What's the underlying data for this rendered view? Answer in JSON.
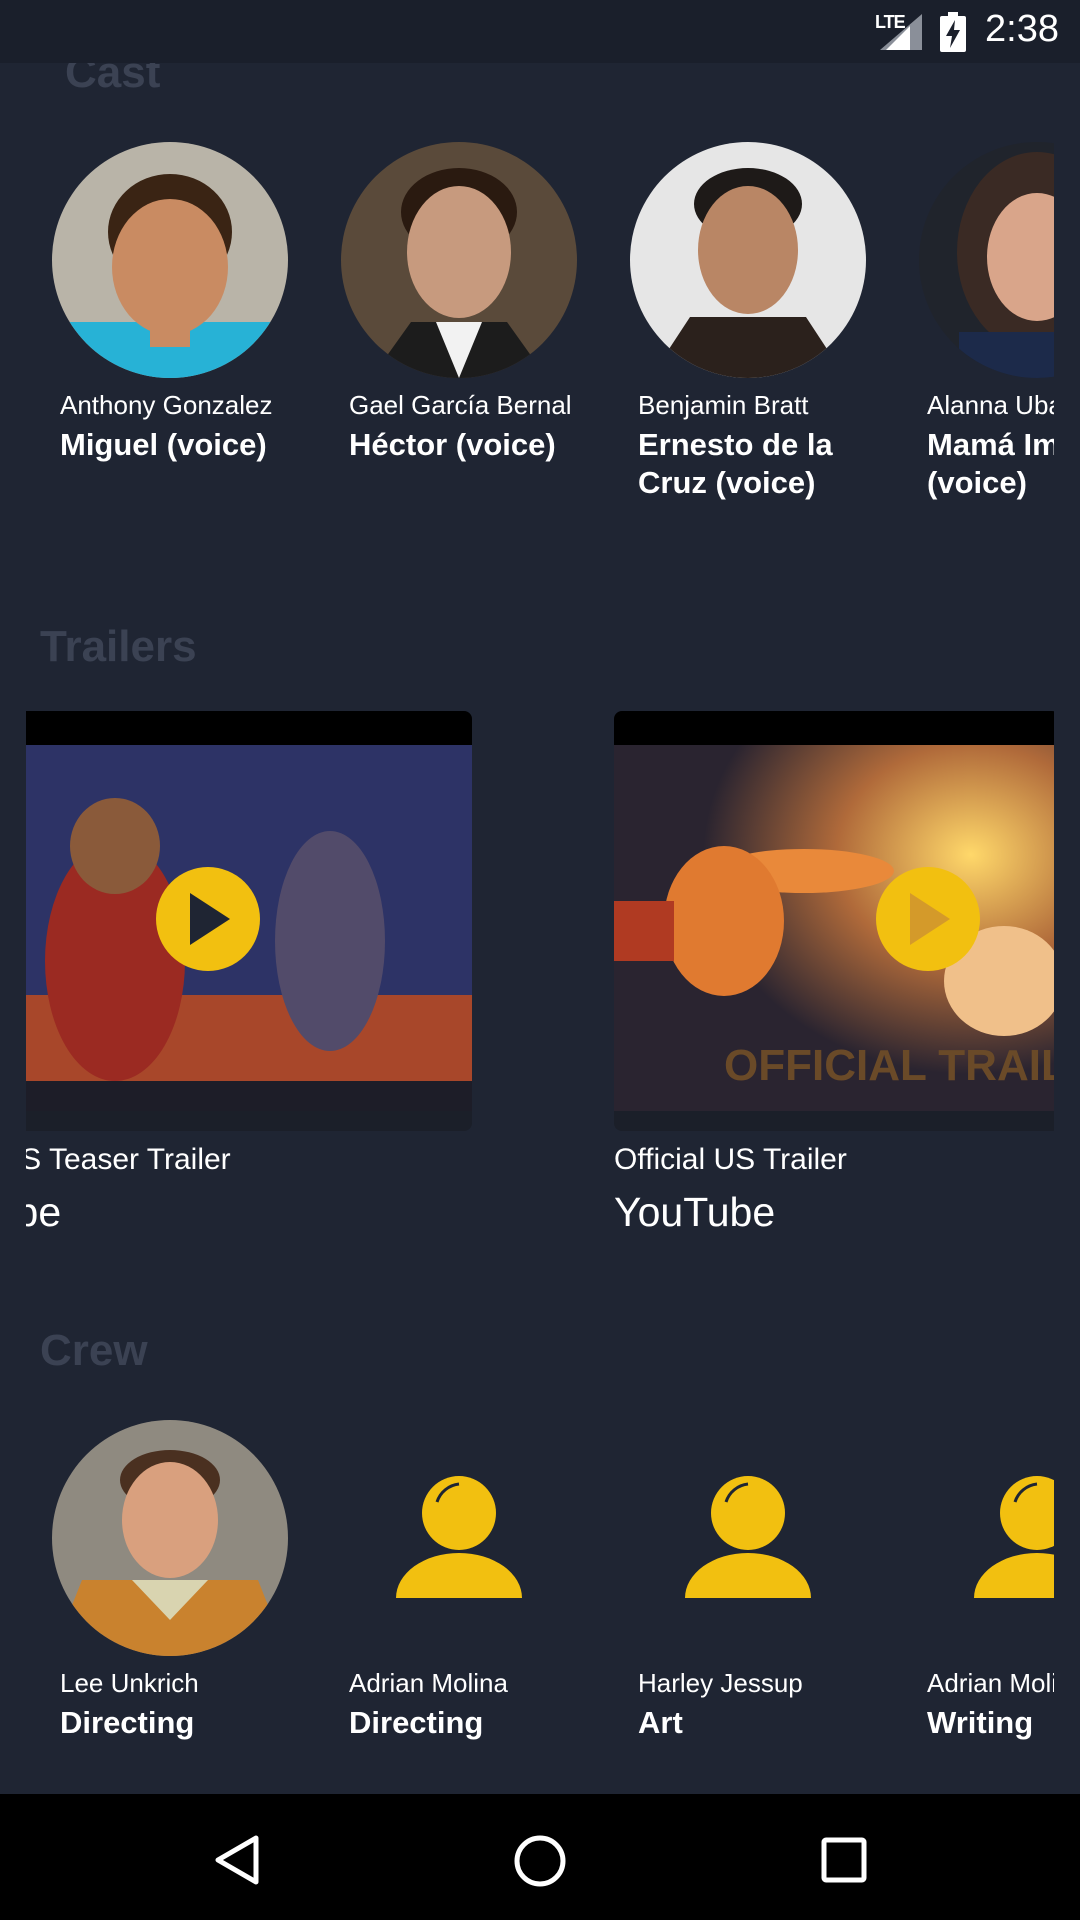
{
  "status_bar": {
    "network": "LTE",
    "time": "2:38"
  },
  "sections": {
    "cast": "Cast",
    "trailers": "Trailers",
    "crew": "Crew"
  },
  "cast": [
    {
      "name": "Anthony Gonzalez",
      "role": "Miguel (voice)"
    },
    {
      "name": "Gael García Bernal",
      "role": "Héctor (voice)"
    },
    {
      "name": "Benjamin Bratt",
      "role": "Ernesto de la Cruz (voice)"
    },
    {
      "name": "Alanna Ubach",
      "role": "Mamá Imelda (voice)"
    }
  ],
  "trailers": [
    {
      "name": "Official US Teaser Trailer",
      "site": "YouTube",
      "overlay_text": ""
    },
    {
      "name": "Official US Trailer",
      "site": "YouTube",
      "overlay_text": "OFFICIAL TRAILER"
    }
  ],
  "crew": [
    {
      "name": "Lee Unkrich",
      "job": "Directing",
      "has_photo": true
    },
    {
      "name": "Adrian Molina",
      "job": "Directing",
      "has_photo": false
    },
    {
      "name": "Harley Jessup",
      "job": "Art",
      "has_photo": false
    },
    {
      "name": "Adrian Molina",
      "job": "Writing",
      "has_photo": false
    }
  ],
  "colors": {
    "background": "#1f2533",
    "accent": "#f2c010",
    "section_title": "#3b4253"
  },
  "icons": {
    "play": "play-icon",
    "placeholder": "person-placeholder-icon",
    "back": "back-triangle-icon",
    "home": "home-circle-icon",
    "recents": "recents-square-icon"
  }
}
